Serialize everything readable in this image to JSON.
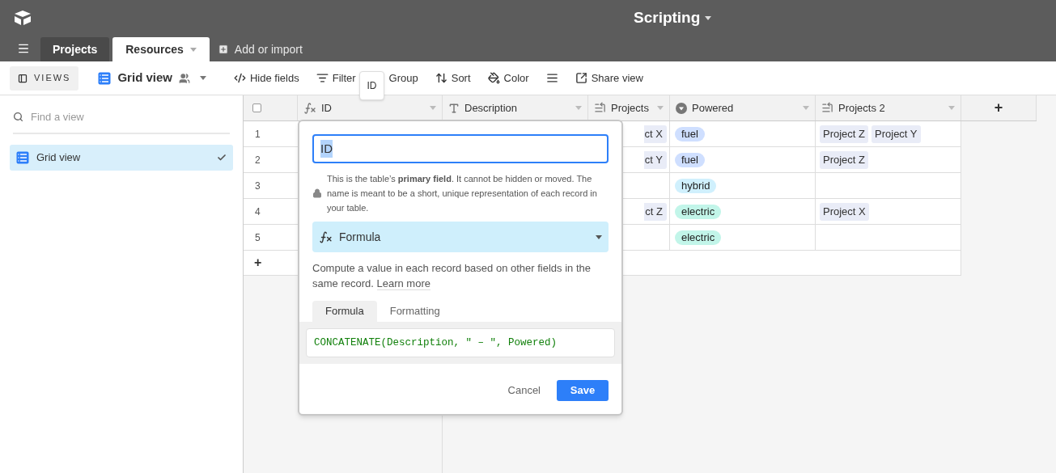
{
  "app": {
    "title": "Scripting"
  },
  "tables": [
    {
      "label": "Projects",
      "selected": false
    },
    {
      "label": "Resources",
      "selected": true
    }
  ],
  "add_table": "Add or import",
  "toolbar": {
    "views_button": "VIEWS",
    "view_name": "Grid view",
    "items": [
      {
        "kind": "hide",
        "label": "Hide fields"
      },
      {
        "kind": "filter",
        "label": "Filter"
      },
      {
        "kind": "group",
        "label": "Group"
      },
      {
        "kind": "sort",
        "label": "Sort"
      },
      {
        "kind": "color",
        "label": "Color"
      },
      {
        "kind": "row_height"
      },
      {
        "kind": "share",
        "label": "Share view"
      }
    ]
  },
  "tooltip": "ID",
  "sidebar": {
    "search_placeholder": "Find a view",
    "views": [
      {
        "label": "Grid view",
        "selected": true
      }
    ]
  },
  "grid": {
    "select_all": {
      "checked": false
    },
    "columns": [
      {
        "name": "ID",
        "kind": "formula"
      },
      {
        "name": "Description",
        "kind": "text"
      },
      {
        "name": "Projects",
        "kind": "link"
      },
      {
        "name": "Powered",
        "kind": "select"
      },
      {
        "name": "Projects 2",
        "kind": "link"
      }
    ],
    "add_column": "+",
    "rows": [
      {
        "number": "1",
        "projects": [
          "ct X"
        ],
        "powered": {
          "label": "fuel",
          "color": "#cfdfff"
        },
        "projects_2": [
          "Project Z",
          "Project Y"
        ]
      },
      {
        "number": "2",
        "projects": [
          "ct Y"
        ],
        "powered": {
          "label": "fuel",
          "color": "#cfdfff"
        },
        "projects_2": [
          "Project Z"
        ]
      },
      {
        "number": "3",
        "powered": {
          "label": "hybrid",
          "color": "#d0f0fd"
        }
      },
      {
        "number": "4",
        "projects": [
          "ct Z"
        ],
        "powered": {
          "label": "electric",
          "color": "#c2f5e9"
        },
        "projects_2": [
          "Project X"
        ]
      },
      {
        "number": "5",
        "powered": {
          "label": "electric",
          "color": "#c2f5e9"
        }
      }
    ],
    "add_row": "+"
  },
  "field_editor": {
    "name_value": "ID",
    "note": "This is the table’s **primary field**. It cannot be hidden or moved. The name is meant to be a short, unique representation of each record in your table.",
    "field_type": "Formula",
    "description": "Compute a value in each record based on other fields in the same record.",
    "learn_more": "Learn more",
    "tabs": [
      {
        "label": "Formula",
        "selected": true
      },
      {
        "label": "Formatting",
        "selected": false
      }
    ],
    "formula": "CONCATENATE(Description, \" – \", Powered)",
    "cancel": "Cancel",
    "save": "Save"
  }
}
